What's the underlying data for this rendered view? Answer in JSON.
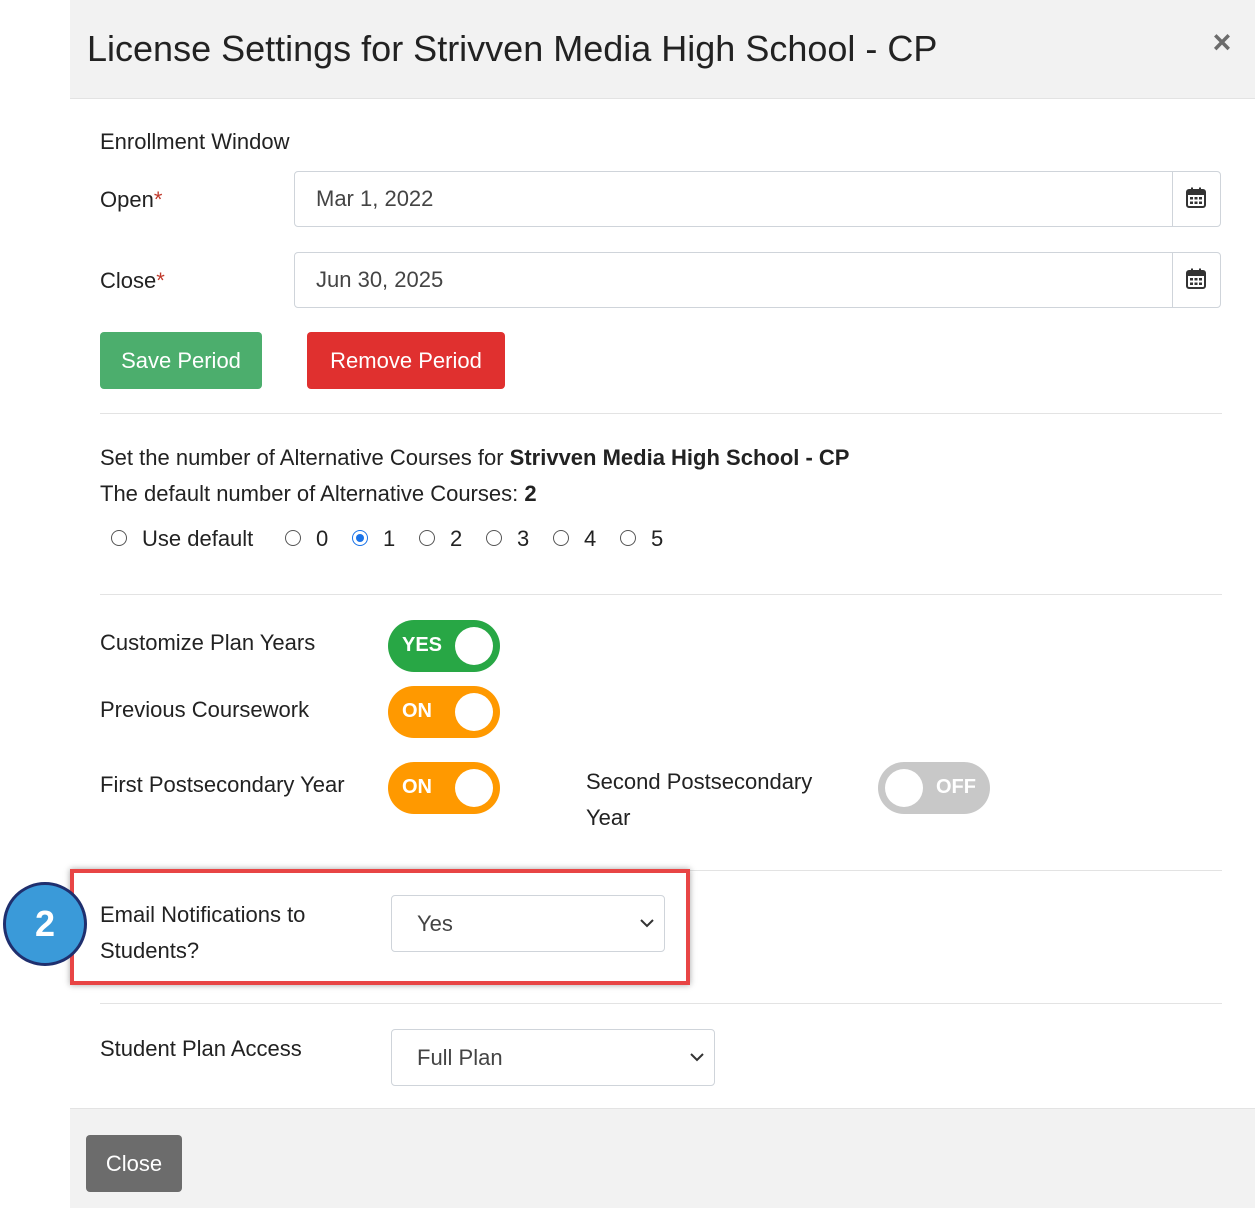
{
  "modal": {
    "title": "License Settings for Strivven Media High School - CP",
    "close_icon": "×"
  },
  "enrollment": {
    "heading": "Enrollment Window",
    "open_label": "Open",
    "close_label": "Close",
    "required_mark": "*",
    "open_value": "Mar 1, 2022",
    "close_value": "Jun 30, 2025",
    "save_button": "Save Period",
    "remove_button": "Remove Period"
  },
  "alternatives": {
    "line1_prefix": "Set the number of Alternative Courses for ",
    "school_name": "Strivven Media High School - CP",
    "line2_prefix": "The default number of Alternative Courses: ",
    "default_count": "2",
    "options": [
      "Use default",
      "0",
      "1",
      "2",
      "3",
      "4",
      "5"
    ],
    "selected": "1"
  },
  "toggles": {
    "customize_plan_years": {
      "label": "Customize Plan Years",
      "state": "YES",
      "color": "#28a745"
    },
    "previous_coursework": {
      "label": "Previous Coursework",
      "state": "ON",
      "color": "#ff9900"
    },
    "first_postsecondary": {
      "label": "First Postsecondary Year",
      "state": "ON",
      "color": "#ff9900"
    },
    "second_postsecondary": {
      "label_line1": "Second Postsecondary",
      "label_line2": "Year",
      "state": "OFF",
      "color": "#c8c8c8"
    }
  },
  "email_notifications": {
    "label_line1": "Email Notifications to",
    "label_line2": "Students?",
    "value": "Yes",
    "step_number": "2",
    "highlight_color": "#e84545"
  },
  "plan_access": {
    "label": "Student Plan Access",
    "value": "Full Plan"
  },
  "footer": {
    "close_button": "Close"
  },
  "icons": {
    "calendar": "calendar-icon",
    "chevron": "chevron-down-icon",
    "close": "close-icon"
  }
}
